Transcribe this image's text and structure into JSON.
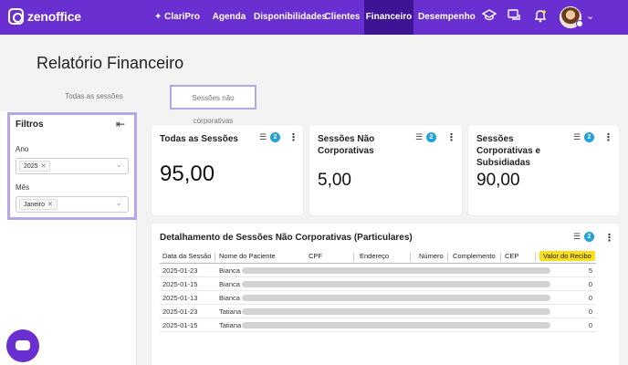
{
  "brand": {
    "name": "zenoffice"
  },
  "nav": {
    "clari": "✦ ClariPro",
    "agenda": "Agenda",
    "disponibilidades": "Disponibilidades",
    "clientes": "Clientes",
    "financeiro": "Financeiro",
    "desempenho": "Desempenho",
    "active": "Financeiro",
    "icons": [
      "graduation-cap-icon",
      "chat-icon",
      "bell-icon"
    ]
  },
  "page": {
    "title": "Relatório Financeiro"
  },
  "tabs": {
    "all": "Todas as sessões",
    "non_corporate": "Sessões não corporativas",
    "active": "Sessões não corporativas"
  },
  "filters": {
    "title": "Filtros",
    "year_label": "Ano",
    "year_chip": "2025",
    "month_label": "Mês",
    "month_chip": "Janeiro"
  },
  "cards": [
    {
      "title": "Todas as Sessões",
      "value": "95,00",
      "filter_count": "2"
    },
    {
      "title": "Sessões Não Corporativas",
      "value": "5,00",
      "filter_count": "2"
    },
    {
      "title": "Sessões Corporativas e Subsidiadas",
      "value": "90,00",
      "filter_count": "2"
    }
  ],
  "table": {
    "title": "Detalhamento de Sessões Não Corporativas (Particulares)",
    "filter_count": "2",
    "columns": [
      "Data da Sessão",
      "Nome do Paciente",
      "CPF",
      "Endereço",
      "Número",
      "Complemento",
      "CEP",
      "Valor do Recibo"
    ],
    "rows": [
      {
        "date": "2025-01-23",
        "name": "Bianca",
        "value": "5"
      },
      {
        "date": "2025-01-15",
        "name": "Bianca",
        "value": "0"
      },
      {
        "date": "2025-01-13",
        "name": "Bianca",
        "value": "0"
      },
      {
        "date": "2025-01-23",
        "name": "Tatiana",
        "value": "0"
      },
      {
        "date": "2025-01-15",
        "name": "Tatiana",
        "value": "0"
      }
    ]
  },
  "colors": {
    "nav": "#6a2fd0",
    "nav_active": "#3d1594",
    "highlight": "#b6a6e8",
    "badge": "#1fa3d9",
    "recibo_header": "#f7df1e"
  }
}
